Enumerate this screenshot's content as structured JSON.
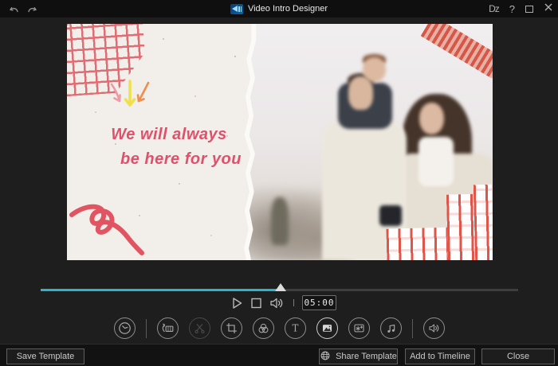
{
  "titlebar": {
    "title": "Video Intro Designer",
    "directorzone": "Dz",
    "help": "?"
  },
  "preview": {
    "caption_line1": "We will always",
    "caption_line2": "be here for you"
  },
  "player": {
    "time": "05:00",
    "progress_fraction": 0.5
  },
  "toolbar": {
    "items": [
      "duration-clock",
      "replace-media",
      "trim-scissors",
      "crop",
      "color-effect",
      "title-text",
      "photo",
      "pip-effects",
      "music",
      "audio-volume"
    ],
    "disabled_item": "trim-scissors",
    "active_item": "photo"
  },
  "footer": {
    "save": "Save Template",
    "share": "Share Template",
    "add": "Add to Timeline",
    "close": "Close"
  },
  "colors": {
    "accent_cyan": "#2db3cb",
    "doodle_red": "#e05561",
    "caption_pink": "#e0506b",
    "paper": "#f2eee9",
    "tape_red": "#d24f40"
  }
}
